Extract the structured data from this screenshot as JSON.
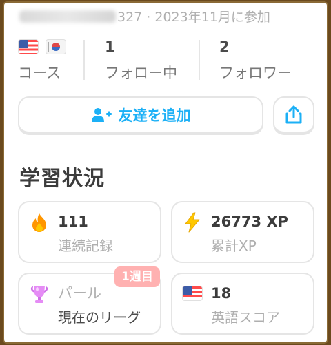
{
  "profile": {
    "join_text": "327 · 2023年11月に参加"
  },
  "stats": {
    "courses_label": "コース",
    "following_count": "1",
    "following_label": "フォロー中",
    "followers_count": "2",
    "followers_label": "フォロワー"
  },
  "actions": {
    "add_friend_label": "友達を追加"
  },
  "progress": {
    "title": "学習状況",
    "streak": {
      "value": "111",
      "label": "連続記録"
    },
    "xp": {
      "value": "26773 XP",
      "label": "累計XP"
    },
    "league": {
      "badge": "1週目",
      "name": "パール",
      "label": "現在のリーグ"
    },
    "score": {
      "value": "18",
      "label": "英語スコア"
    }
  },
  "colors": {
    "accent": "#1cb0f6",
    "streak": "#ff9600",
    "xp": "#ffc800",
    "league": "#e58cf5",
    "badge": "#ffb1b1"
  },
  "icons": [
    "us-flag-icon",
    "korea-flag-icon",
    "add-user-icon",
    "share-icon",
    "flame-icon",
    "lightning-icon",
    "pearl-trophy-icon",
    "us-flag-icon"
  ]
}
